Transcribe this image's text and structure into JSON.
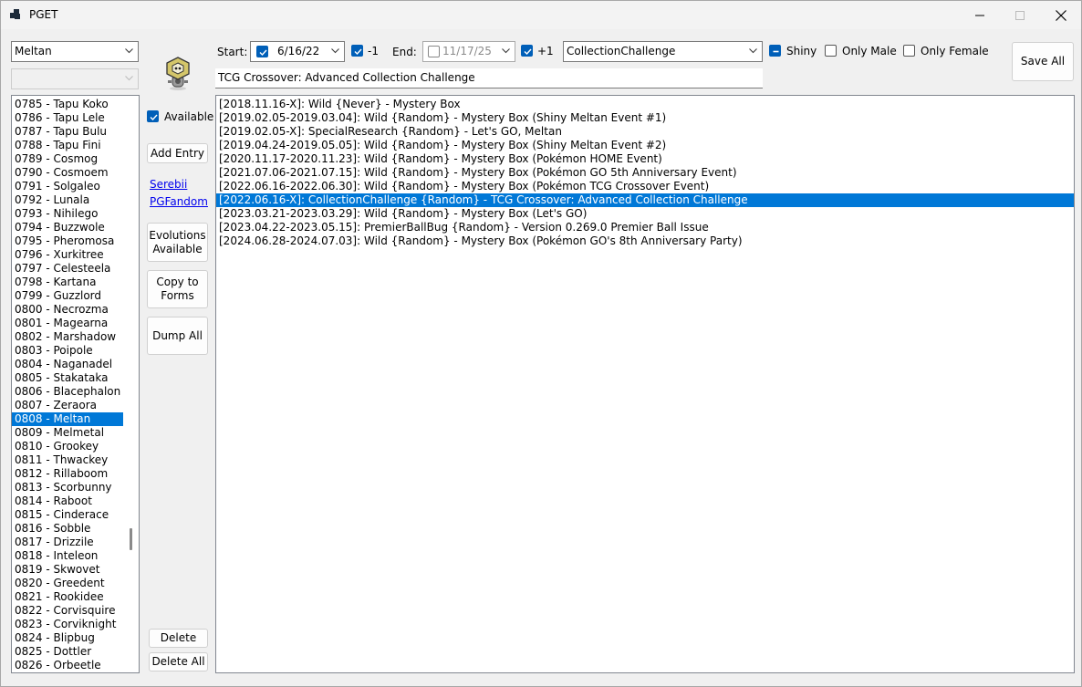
{
  "window": {
    "title": "PGET"
  },
  "species_combo": {
    "value": "Meltan"
  },
  "form_combo": {
    "value": ""
  },
  "species_list": [
    "0785 - Tapu Koko",
    "0786 - Tapu Lele",
    "0787 - Tapu Bulu",
    "0788 - Tapu Fini",
    "0789 - Cosmog",
    "0790 - Cosmoem",
    "0791 - Solgaleo",
    "0792 - Lunala",
    "0793 - Nihilego",
    "0794 - Buzzwole",
    "0795 - Pheromosa",
    "0796 - Xurkitree",
    "0797 - Celesteela",
    "0798 - Kartana",
    "0799 - Guzzlord",
    "0800 - Necrozma",
    "0801 - Magearna",
    "0802 - Marshadow",
    "0803 - Poipole",
    "0804 - Naganadel",
    "0805 - Stakataka",
    "0806 - Blacephalon",
    "0807 - Zeraora",
    "0808 - Meltan",
    "0809 - Melmetal",
    "0810 - Grookey",
    "0811 - Thwackey",
    "0812 - Rillaboom",
    "0813 - Scorbunny",
    "0814 - Raboot",
    "0815 - Cinderace",
    "0816 - Sobble",
    "0817 - Drizzile",
    "0818 - Inteleon",
    "0819 - Skwovet",
    "0820 - Greedent",
    "0821 - Rookidee",
    "0822 - Corvisquire",
    "0823 - Corviknight",
    "0824 - Blipbug",
    "0825 - Dottler",
    "0826 - Orbeetle"
  ],
  "species_selected": "0808 - Meltan",
  "side": {
    "available_label": "Available",
    "add_entry": "Add Entry",
    "serebii": "Serebii",
    "pgfandom": "PGFandom",
    "evolutions_line1": "Evolutions",
    "evolutions_line2": "Available",
    "copy_line1": "Copy to",
    "copy_line2": "Forms",
    "dump_all": "Dump All",
    "delete": "Delete",
    "delete_all": "Delete All"
  },
  "top": {
    "start_label": "Start:",
    "start_date": "6/16/22",
    "minus_one": "-1",
    "end_label": "End:",
    "end_date": "11/17/25",
    "plus_one": "+1",
    "type_combo": "CollectionChallenge",
    "shiny": "Shiny",
    "only_male": "Only Male",
    "only_female": "Only Female",
    "save_all": "Save All",
    "event_name": "TCG Crossover: Advanced Collection Challenge"
  },
  "entries": [
    "[2018.11.16-X]: Wild {Never} - Mystery Box",
    "[2019.02.05-2019.03.04]: Wild {Random} - Mystery Box (Shiny Meltan Event #1)",
    "[2019.02.05-X]: SpecialResearch {Random} - Let's GO, Meltan",
    "[2019.04.24-2019.05.05]: Wild {Random} - Mystery Box (Shiny Meltan Event #2)",
    "[2020.11.17-2020.11.23]: Wild {Random} - Mystery Box (Pokémon HOME Event)",
    "[2021.07.06-2021.07.15]: Wild {Random} - Mystery Box (Pokémon GO 5th Anniversary Event)",
    "[2022.06.16-2022.06.30]: Wild {Random} - Mystery Box (Pokémon TCG Crossover Event)",
    "[2022.06.16-X]: CollectionChallenge {Random} - TCG Crossover: Advanced Collection Challenge",
    "[2023.03.21-2023.03.29]: Wild {Random} - Mystery Box (Let's GO)",
    "[2023.04.22-2023.05.15]: PremierBallBug {Random} - Version 0.269.0 Premier Ball Issue",
    "[2024.06.28-2024.07.03]: Wild {Random} - Mystery Box (Pokémon GO's 8th Anniversary Party)"
  ],
  "entries_selected_index": 7,
  "colors": {
    "selection": "#0078d7",
    "checkbox": "#005fb8",
    "link": "#0000ee"
  },
  "icons": [
    "app-icon",
    "minimize-icon",
    "maximize-icon",
    "close-icon",
    "chevron-down-icon",
    "checkmark-icon",
    "meltan-sprite-icon"
  ]
}
